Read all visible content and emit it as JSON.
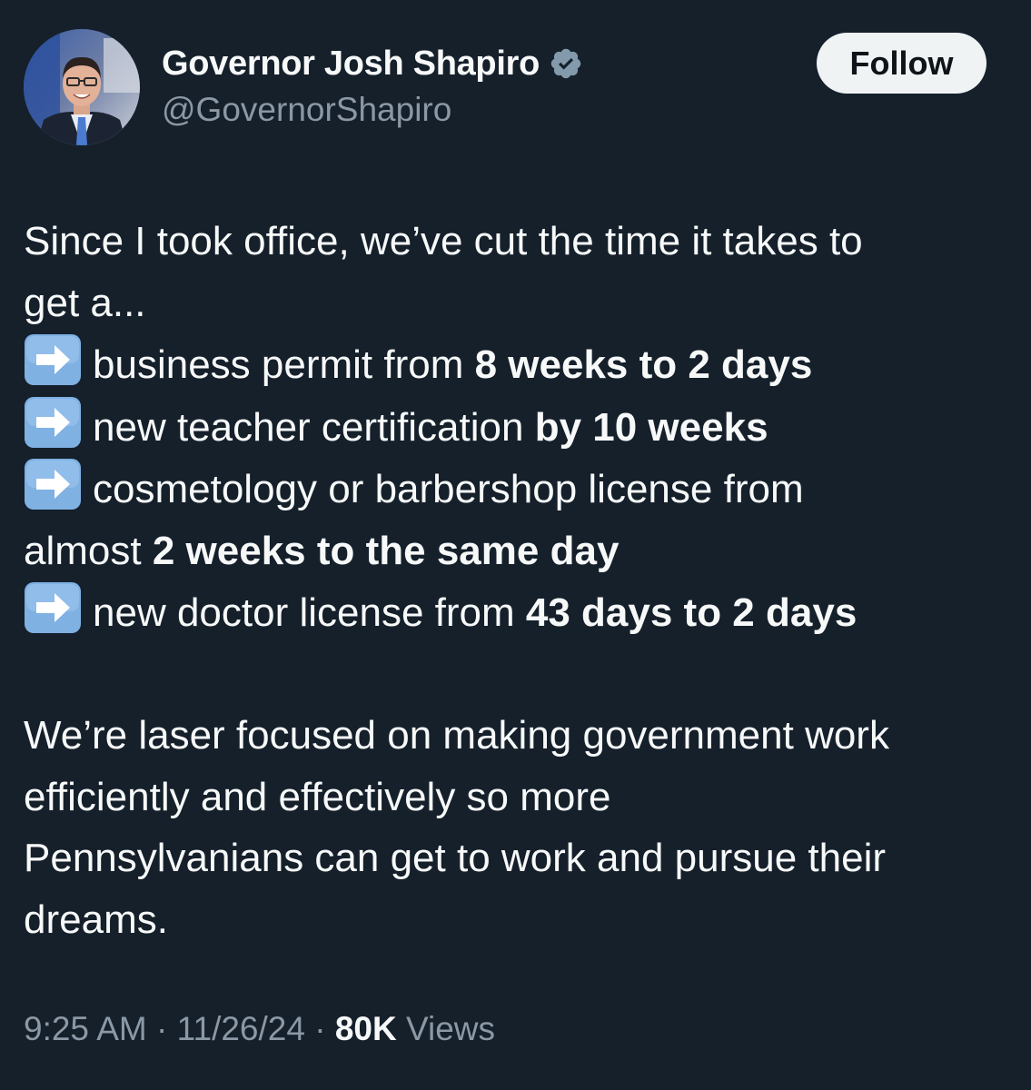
{
  "author": {
    "display_name": "Governor Josh Shapiro",
    "handle": "@GovernorShapiro",
    "verified_icon": "verified-badge-icon",
    "avatar": "profile-photo"
  },
  "follow_label": "Follow",
  "tweet": {
    "intro_1": "Since I took office, we’ve cut the time it takes to",
    "intro_2": "get a...",
    "items": [
      {
        "icon": "right-arrow-emoji-icon",
        "text": "business permit from ",
        "bold": "8 weeks to 2 days"
      },
      {
        "icon": "right-arrow-emoji-icon",
        "text": "new teacher certification ",
        "bold": "by 10 weeks"
      },
      {
        "icon": "right-arrow-emoji-icon",
        "text": "cosmetology or barbershop license from",
        "cont_text": "almost ",
        "cont_bold": "2 weeks to the same day"
      },
      {
        "icon": "right-arrow-emoji-icon",
        "text": "new doctor license from ",
        "bold": "43 days to 2 days"
      }
    ],
    "closing_lines": [
      "We’re laser focused on making government work",
      "efficiently and effectively so more",
      "Pennsylvanians can get to work and pursue their",
      "dreams."
    ]
  },
  "meta": {
    "time": "9:25 AM",
    "separator": " · ",
    "date": "11/26/24",
    "views_count": "80K",
    "views_label": " Views"
  },
  "colors": {
    "background": "#15202b",
    "text_primary": "#f7f9f9",
    "text_secondary": "#8b98a5",
    "follow_bg": "#eff3f4",
    "arrow_emoji_bg": "#7fb1e3"
  }
}
